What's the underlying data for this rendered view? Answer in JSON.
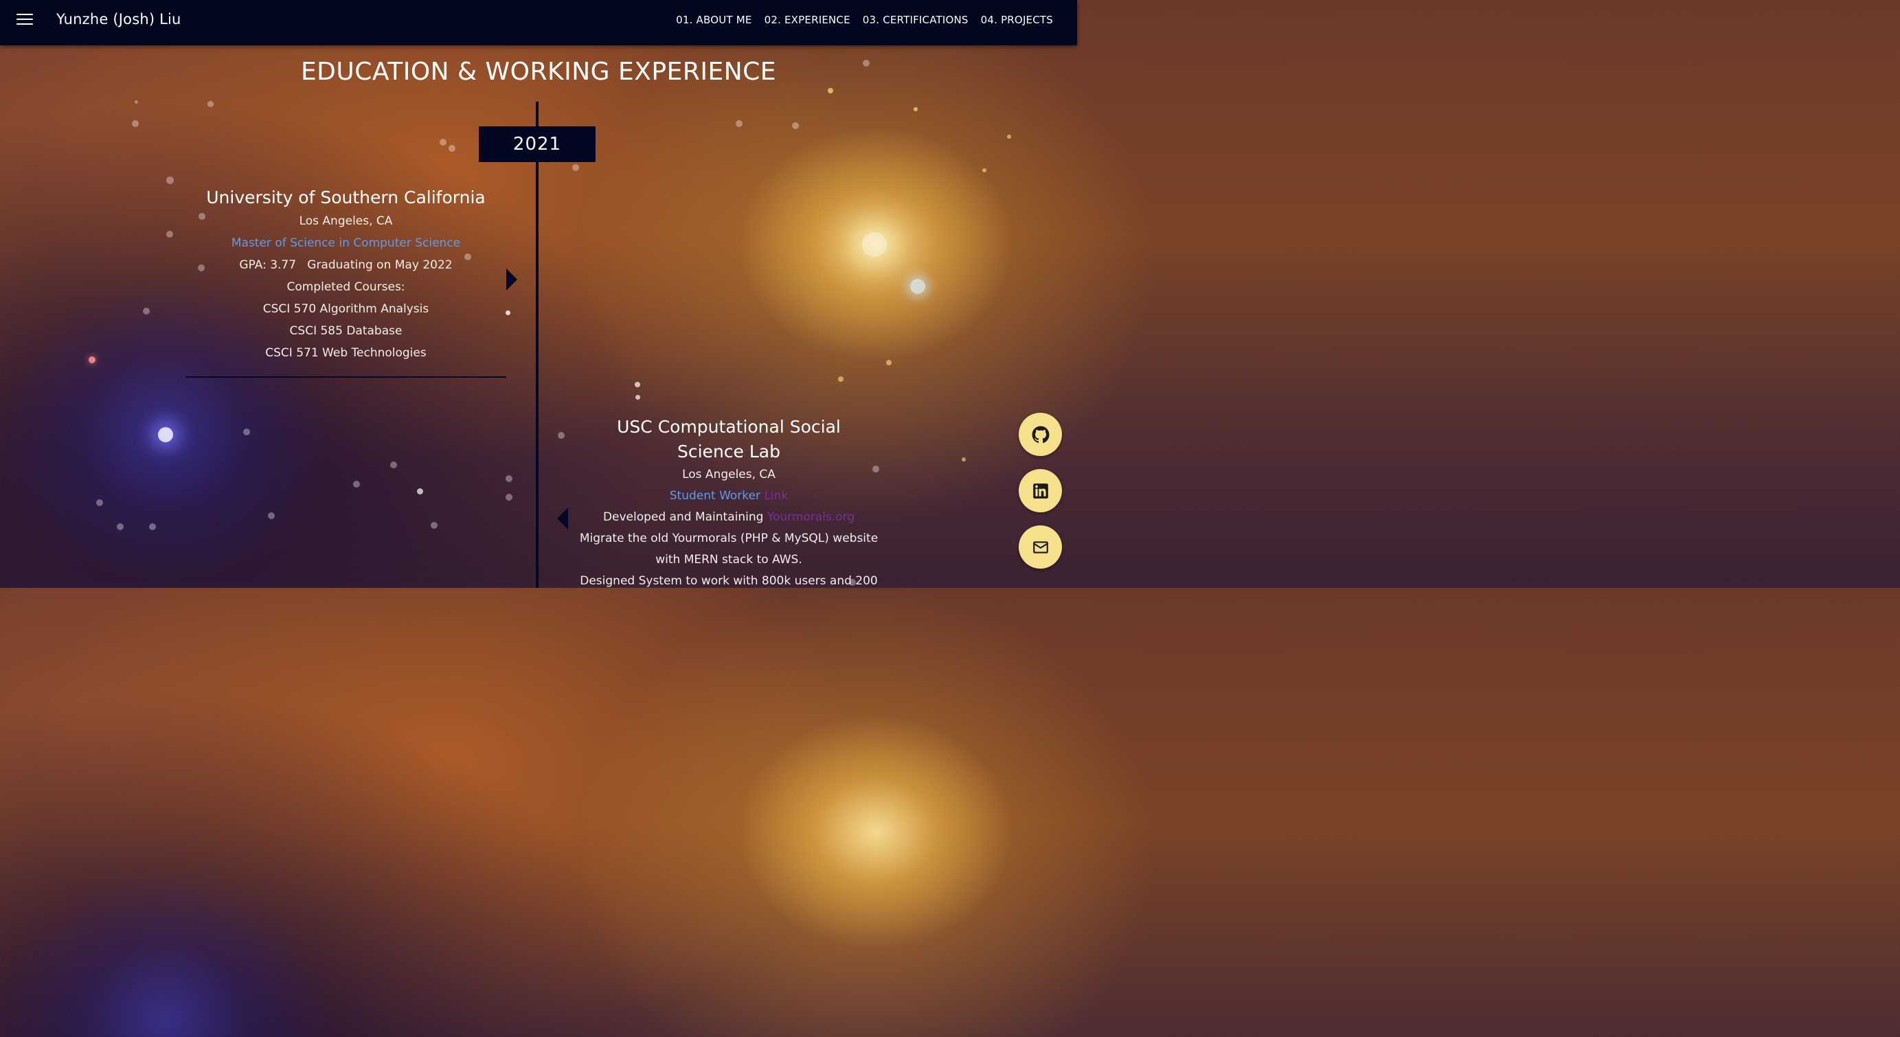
{
  "header": {
    "brand": "Yunzhe (Josh) Liu",
    "nav": [
      {
        "label": "01. ABOUT ME"
      },
      {
        "label": "02. EXPERIENCE"
      },
      {
        "label": "03. CERTIFICATIONS"
      },
      {
        "label": "04. PROJECTS"
      }
    ]
  },
  "section": {
    "title": "EDUCATION & WORKING EXPERIENCE",
    "year": "2021"
  },
  "education": {
    "org": "University of Southern California",
    "location": "Los Angeles, CA",
    "degree": "Master of Science in Computer Science",
    "gpa": "GPA: 3.77",
    "graduation": "Graduating on May 2022",
    "courses_label": "Completed Courses:",
    "courses": [
      "CSCI 570 Algorithm Analysis",
      "CSCI 585 Database",
      "CSCI 571 Web Technologies"
    ]
  },
  "work": {
    "org_line1": "USC Computational Social",
    "org_line2": "Science Lab",
    "location": "Los Angeles, CA",
    "role": "Student Worker",
    "role_link": "Link",
    "dev_prefix": "Developed and Maintaining",
    "dev_link": "Yourmorals.org",
    "desc1": "Migrate the old Yourmorals (PHP & MySQL) website",
    "desc2": "with MERN stack to AWS.",
    "desc3": "Designed System to work with 800k users and 200"
  },
  "social": [
    {
      "icon": "github-icon"
    },
    {
      "icon": "linkedin-icon"
    },
    {
      "icon": "mail-icon"
    }
  ],
  "colors": {
    "navbar": "#03061f",
    "timeline": "#050826",
    "link_blue": "#5d9cec",
    "link_purple": "#7a2e9c",
    "fab": "#f5e08c"
  }
}
